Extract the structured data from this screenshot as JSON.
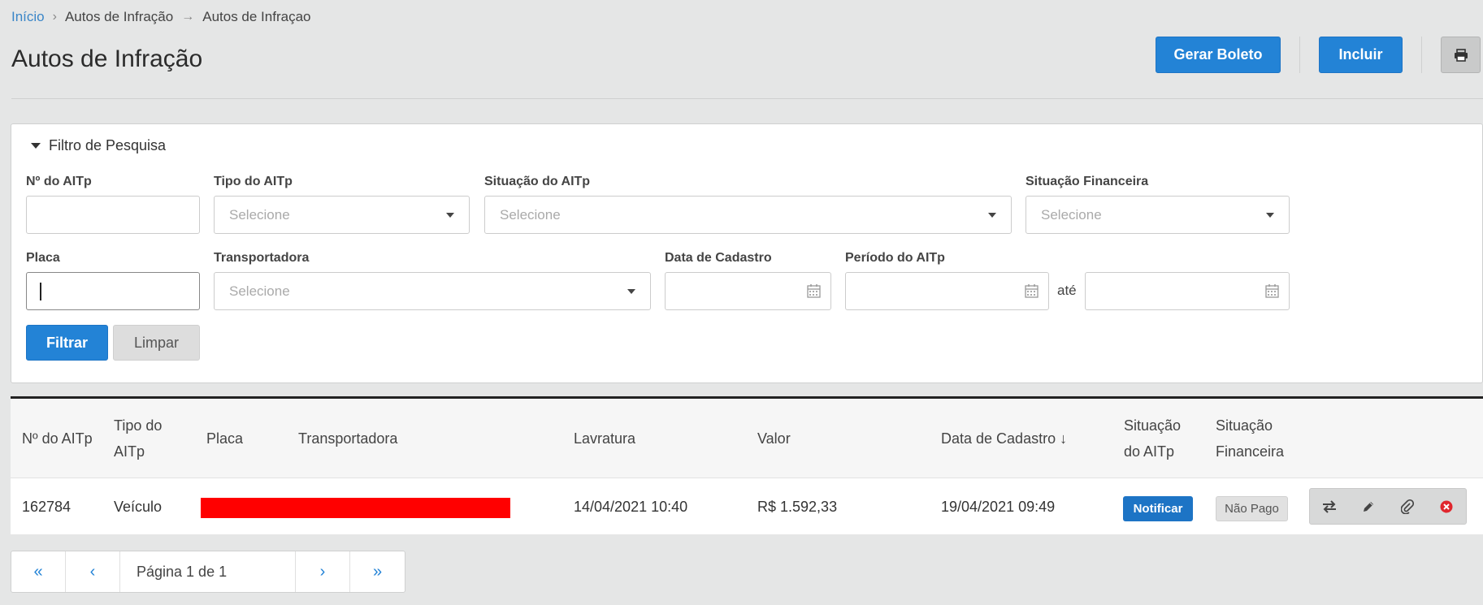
{
  "breadcrumb": {
    "home": "Início",
    "level1": "Autos de Infração",
    "level2": "Autos de Infraçao"
  },
  "page": {
    "title": "Autos de Infração"
  },
  "toolbar": {
    "gerar_boleto": "Gerar Boleto",
    "incluir": "Incluir",
    "print_icon": "printer-icon"
  },
  "filter": {
    "title": "Filtro de Pesquisa",
    "n_aitp_label": "Nº do AITp",
    "tipo_label": "Tipo do AITp",
    "situacao_label": "Situação do AITp",
    "situacao_fin_label": "Situação Financeira",
    "placa_label": "Placa",
    "transportadora_label": "Transportadora",
    "data_cadastro_label": "Data de Cadastro",
    "periodo_label": "Período do AITp",
    "ate": "até",
    "select_placeholder": "Selecione",
    "filtrar": "Filtrar",
    "limpar": "Limpar"
  },
  "table": {
    "headers": {
      "n_aitp": "Nº do AITp",
      "tipo_l1": "Tipo do",
      "tipo_l2": "AITp",
      "placa": "Placa",
      "transportadora": "Transportadora",
      "lavratura": "Lavratura",
      "valor": "Valor",
      "data_cadastro": "Data de Cadastro ↓",
      "situacao_l1": "Situação",
      "situacao_l2": "do AITp",
      "fin_l1": "Situação",
      "fin_l2": "Financeira"
    },
    "rows": [
      {
        "n_aitp": "162784",
        "tipo": "Veículo",
        "lavratura": "14/04/2021 10:40",
        "valor": "R$ 1.592,33",
        "data_cadastro": "19/04/2021 09:49",
        "situacao_action": "Notificar",
        "situacao_financeira": "Não Pago"
      }
    ]
  },
  "pager": {
    "text": "Página 1 de 1",
    "first": "«",
    "prev": "‹",
    "next": "›",
    "last": "»"
  },
  "colors": {
    "primary": "#2383d6",
    "redacted": "#ff0000",
    "danger": "#e0262d"
  }
}
